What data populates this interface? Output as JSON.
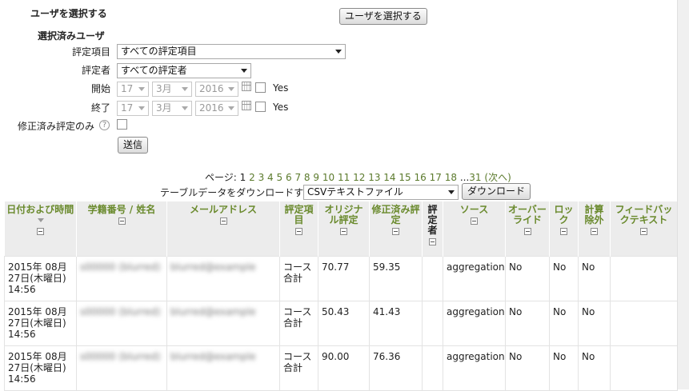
{
  "user_select": {
    "heading": "ユーザを選択する",
    "button_label": "ユーザを選択する"
  },
  "filter": {
    "selected_users_heading": "選択済みユーザ",
    "grade_item_label": "評定項目",
    "grade_item_value": "すべての評定項目",
    "grader_label": "評定者",
    "grader_value": "すべての評定者",
    "start_label": "開始",
    "start": {
      "day": "17",
      "month": "3月",
      "year": "2016",
      "enable_label": "Yes"
    },
    "end_label": "終了",
    "end": {
      "day": "17",
      "month": "3月",
      "year": "2016",
      "enable_label": "Yes"
    },
    "revised_only_label": "修正済み評定のみ",
    "help_symbol": "?",
    "submit_label": "送信"
  },
  "paging": {
    "prefix": "ページ:",
    "current": "1",
    "pages": [
      "2",
      "3",
      "4",
      "5",
      "6",
      "7",
      "8",
      "9",
      "10",
      "11",
      "12",
      "13",
      "14",
      "15",
      "16",
      "17",
      "18"
    ],
    "ellipsis": "...",
    "last": "31",
    "next": "(次へ)"
  },
  "download": {
    "label": "テーブルデータをダウンロードする:",
    "format": "CSVテキストファイル",
    "button_label": "ダウンロード"
  },
  "table": {
    "headers": [
      "日付および時間",
      "学籍番号 / 姓名",
      "メールアドレス",
      "評定項目",
      "オリジナル評定",
      "修正済み評定",
      "評定者",
      "ソース",
      "オーバーライド",
      "ロック",
      "計算除外",
      "フィードバックテキスト"
    ],
    "rows": [
      {
        "date": "2015年 08月 27日(木曜日) 14:56",
        "student": "s00000 (blurred)",
        "email": "blurred@example",
        "item": "コース合計",
        "original": "70.77",
        "revised": "59.35",
        "grader": "",
        "source": "aggregation",
        "overridden": "No",
        "locked": "No",
        "excluded": "No",
        "feedback": ""
      },
      {
        "date": "2015年 08月 27日(木曜日) 14:56",
        "student": "s00000 (blurred)",
        "email": "blurred@example",
        "item": "コース合計",
        "original": "50.43",
        "revised": "41.43",
        "grader": "",
        "source": "aggregation",
        "overridden": "No",
        "locked": "No",
        "excluded": "No",
        "feedback": ""
      },
      {
        "date": "2015年 08月 27日(木曜日) 14:56",
        "student": "s00000 (blurred)",
        "email": "blurred@example",
        "item": "コース合計",
        "original": "90.00",
        "revised": "76.36",
        "grader": "",
        "source": "aggregation",
        "overridden": "No",
        "locked": "No",
        "excluded": "No",
        "feedback": ""
      }
    ]
  },
  "colors": {
    "header_link": "#6a8a2d",
    "page_link": "#5b7a2c",
    "header_bg": "#ececec"
  }
}
